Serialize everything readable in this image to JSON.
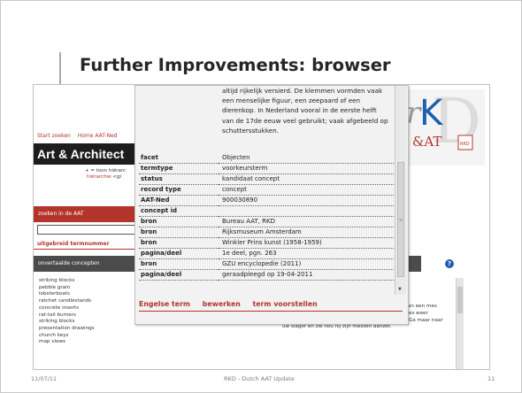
{
  "slide": {
    "title": "Further Improvements: browser",
    "footer_date": "11/07/11",
    "footer_center": "RKD - Dutch AAT Update",
    "page_number": "11"
  },
  "site": {
    "nav": [
      "Start zoeken",
      "Home AAT-Ned"
    ],
    "logo": "Art & Architect",
    "toon_hint": "+ = toon hiërarc",
    "hier_link": "hiërarchie",
    "hier_rest": "<gi",
    "zoek_title": "zoeken in de AAT",
    "search_value": "",
    "links": [
      "uitgebreid",
      "termnummer"
    ],
    "onv_title": "onvertaalde concepten",
    "concepts": [
      "striking blocks",
      "pebble grain",
      "lobsterboats",
      "ratchet candlestands",
      "concrete inserts",
      "rat-tail burners",
      "striking blocks",
      "presentation drawings",
      "church keys",
      "map views"
    ],
    "logo_letters": {
      "r": "r",
      "K": "K",
      "A": "&AT",
      "D": "D",
      "RKD": "RKD"
    },
    "description": "stalen geruwde ronde staaf waarmee de bramen van een mes verwijderd dan wel rechtgezet worden zodat het mes weer helemaal recht is en de snede makkelijk afwikkelt. Ga maar naar uw slager en zie hou hij zijn messen aanzet."
  },
  "popup": {
    "text": "altijd rijkelijk versierd. De klemmen vormden vaak een menselijke figuur, een zeepaard of een dierenkop. In Nederland vooral in de eerste helft van de 17de eeuw veel gebruikt; vaak afgebeeld op schuttersstukken.",
    "rows": [
      {
        "key": "facet",
        "value": "Objecten"
      },
      {
        "key": "termtype",
        "value": "voorkeursterm"
      },
      {
        "key": "status",
        "value": "kandidaat concept"
      },
      {
        "key": "record type",
        "value": "concept"
      },
      {
        "key": "AAT-Ned",
        "value": "900030890"
      },
      {
        "key": "concept id",
        "value": ""
      },
      {
        "key": "bron",
        "value": "Bureau AAT, RKD"
      },
      {
        "key": "bron",
        "value": "Rijksmuseum Amsterdam"
      },
      {
        "key": "bron",
        "value": "Winkler Prins kunst (1958-1959)"
      },
      {
        "key": "pagina/deel",
        "value": "1e deel, pgn. 263"
      },
      {
        "key": "bron",
        "value": "GZU encyclopedie (2011)"
      },
      {
        "key": "pagina/deel",
        "value": "geraadpleegd op 19-04-2011"
      }
    ],
    "actions": [
      "Engelse term",
      "bewerken",
      "term voorstellen"
    ]
  },
  "colors": {
    "accent": "#b3342c",
    "dark_bar": "#4b4b4b",
    "logo_blue": "#1f5fae"
  }
}
